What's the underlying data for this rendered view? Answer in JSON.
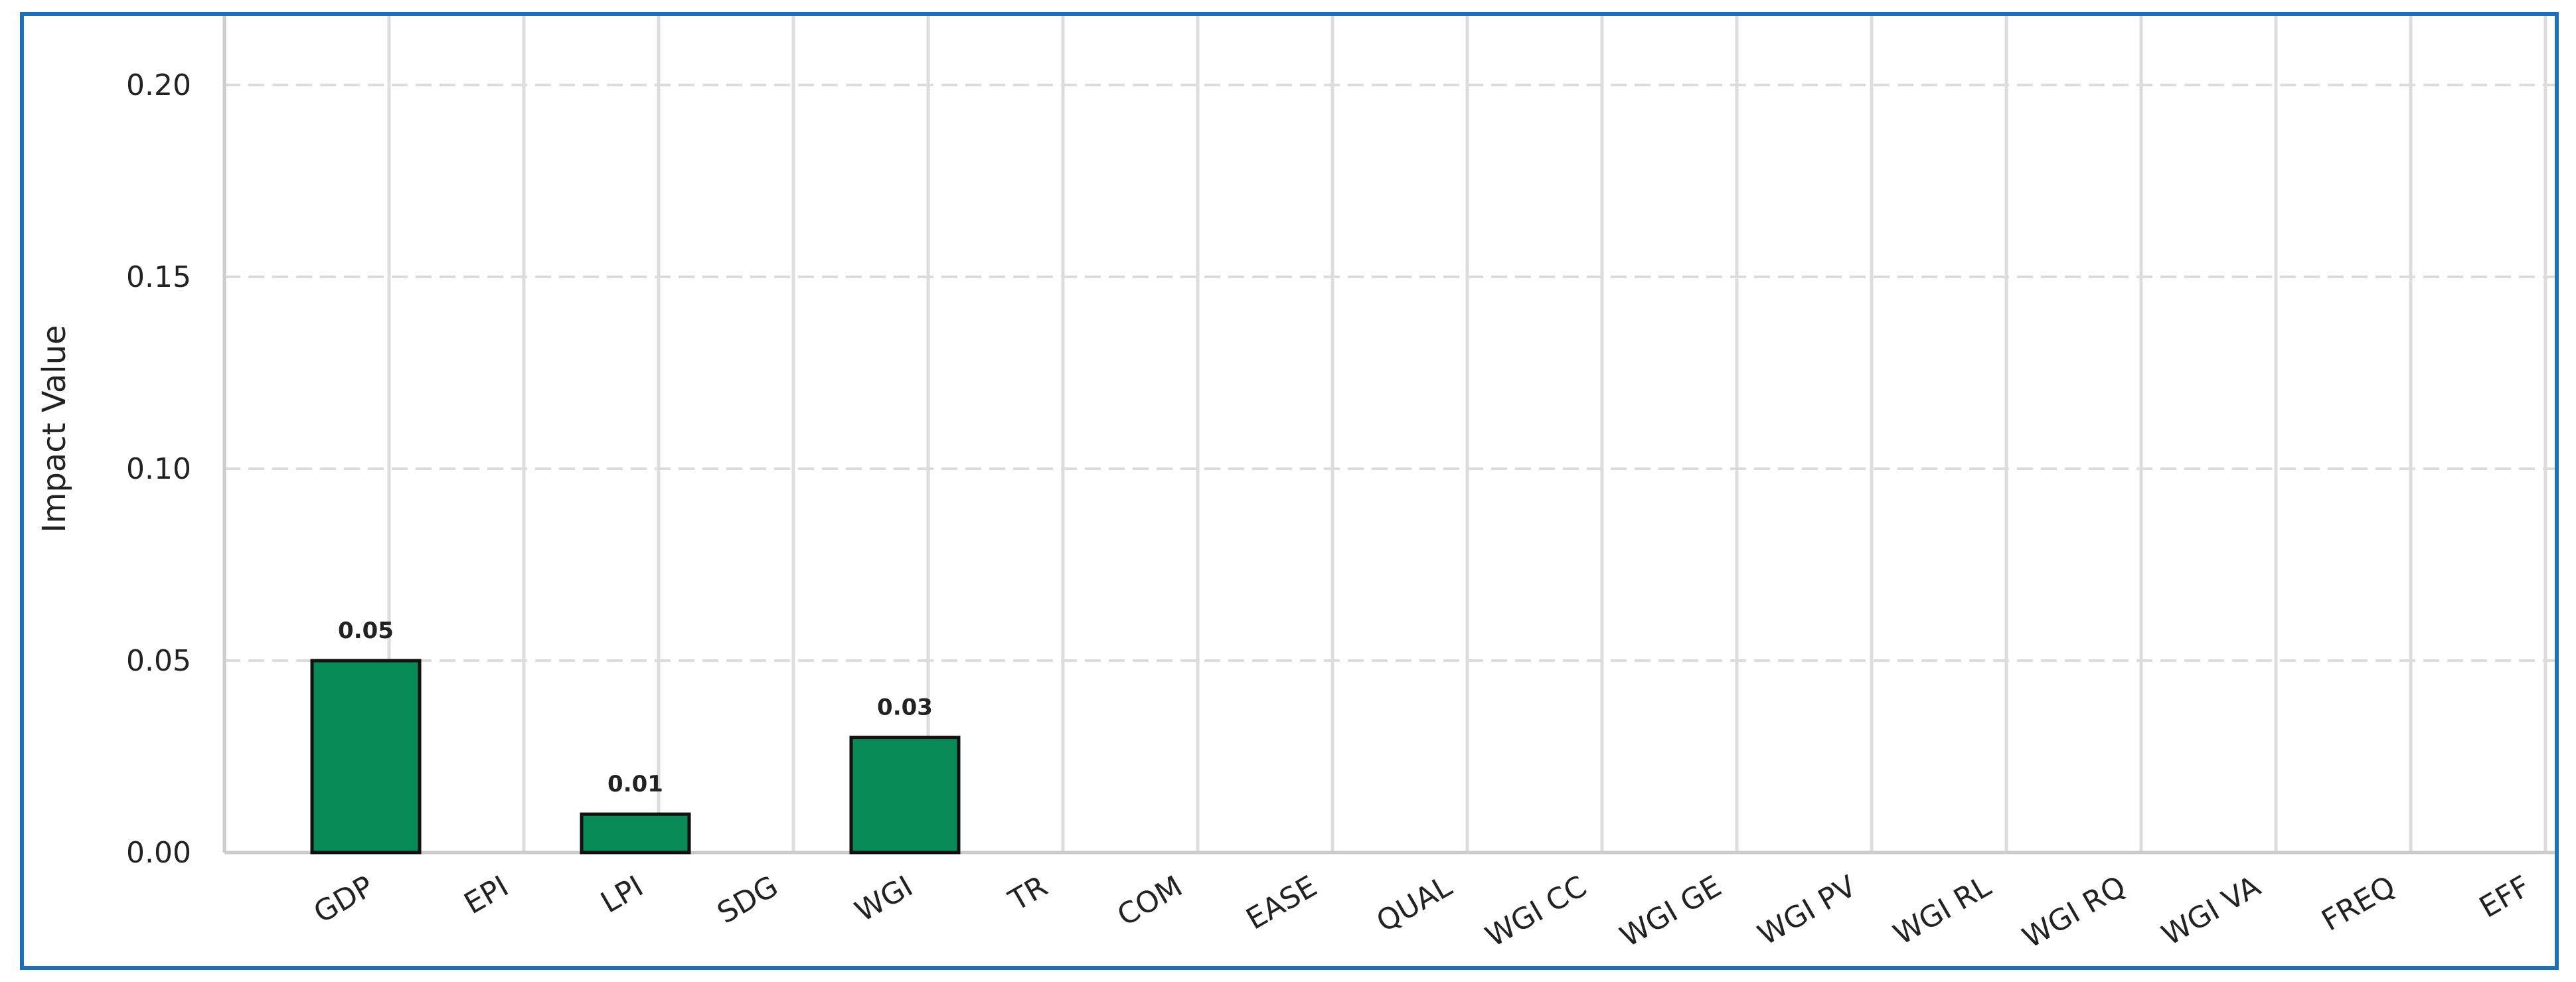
{
  "chart_data": {
    "type": "bar",
    "title": "",
    "xlabel": "",
    "ylabel": "Impact Value",
    "ylim": [
      0,
      0.2
    ],
    "yticks": [
      "0.00",
      "0.05",
      "0.10",
      "0.15",
      "0.20"
    ],
    "ytick_values": [
      0,
      0.05,
      0.1,
      0.15,
      0.2
    ],
    "grid": "on",
    "categories": [
      "GDP",
      "EPI",
      "LPI",
      "SDG",
      "WGI",
      "TR",
      "COM",
      "EASE",
      "QUAL",
      "WGI CC",
      "WGI GE",
      "WGI PV",
      "WGI RL",
      "WGI RQ",
      "WGI VA",
      "FREQ",
      "EFF"
    ],
    "values": [
      0.05,
      0,
      0.01,
      0,
      0.03,
      0,
      0,
      0,
      0,
      0,
      0,
      0,
      0,
      0,
      0,
      0,
      0
    ],
    "data_labels": [
      "0.05",
      "",
      "0.01",
      "",
      "0.03",
      "",
      "",
      "",
      "",
      "",
      "",
      "",
      "",
      "",
      "",
      "",
      ""
    ],
    "bar_color": "#078a55",
    "bar_edge_color": "#111111",
    "frame_color": "#1f6fb8"
  }
}
